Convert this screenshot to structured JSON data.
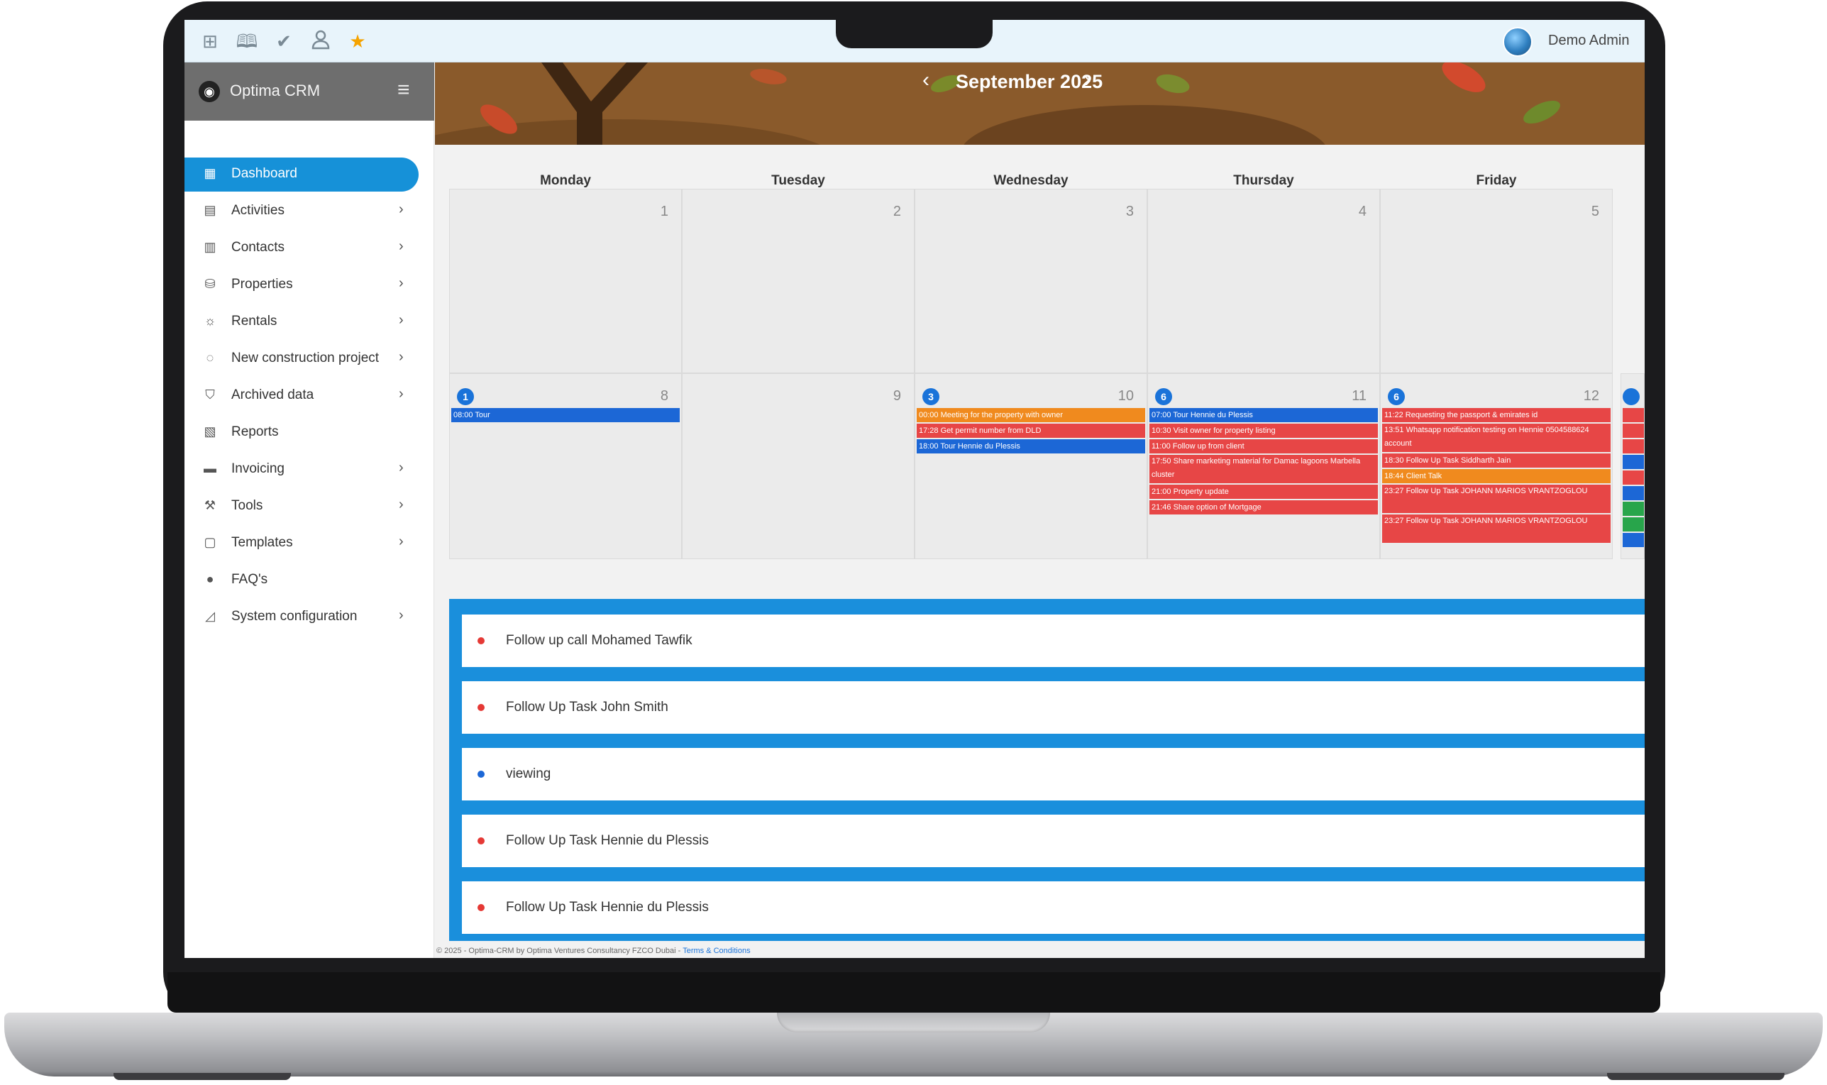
{
  "topbar": {
    "icons": [
      "grid-icon",
      "book-icon",
      "check-icon",
      "user-icon",
      "star-icon"
    ],
    "user_name": "Demo Admin"
  },
  "sidebar": {
    "brand": "Optima CRM",
    "items": [
      {
        "label": "Dashboard",
        "icon": "dashboard-icon",
        "active": true,
        "has_children": false
      },
      {
        "label": "Activities",
        "icon": "activities-icon",
        "has_children": true
      },
      {
        "label": "Contacts",
        "icon": "contacts-icon",
        "has_children": true
      },
      {
        "label": "Properties",
        "icon": "properties-icon",
        "has_children": true
      },
      {
        "label": "Rentals",
        "icon": "rentals-icon",
        "has_children": true
      },
      {
        "label": "New construction project",
        "icon": "construction-icon",
        "has_children": true
      },
      {
        "label": "Archived data",
        "icon": "archive-icon",
        "has_children": true
      },
      {
        "label": "Reports",
        "icon": "reports-icon",
        "has_children": false
      },
      {
        "label": "Invoicing",
        "icon": "invoicing-icon",
        "has_children": true
      },
      {
        "label": "Tools",
        "icon": "tools-icon",
        "has_children": true
      },
      {
        "label": "Templates",
        "icon": "templates-icon",
        "has_children": true
      },
      {
        "label": "FAQ's",
        "icon": "faq-icon",
        "has_children": false
      },
      {
        "label": "System configuration",
        "icon": "settings-icon",
        "has_children": true
      }
    ]
  },
  "calendar": {
    "title": "September 2025",
    "prev": "‹",
    "next": "›",
    "weekdays": [
      "Monday",
      "Tuesday",
      "Wednesday",
      "Thursday",
      "Friday"
    ],
    "week1": [
      "1",
      "2",
      "3",
      "4",
      "5"
    ],
    "week2": [
      {
        "day": "8",
        "badge": "1",
        "events": [
          {
            "text": "08:00 Tour",
            "color": "blue"
          }
        ]
      },
      {
        "day": "9",
        "badge": "",
        "events": []
      },
      {
        "day": "10",
        "badge": "3",
        "events": [
          {
            "text": "00:00 Meeting for the property with owner",
            "color": "orange"
          },
          {
            "text": "17:28 Get permit number from DLD",
            "color": "red"
          },
          {
            "text": "18:00 Tour Hennie du Plessis",
            "color": "blue"
          }
        ]
      },
      {
        "day": "11",
        "badge": "6",
        "events": [
          {
            "text": "07:00 Tour Hennie du Plessis",
            "color": "blue"
          },
          {
            "text": "10:30 Visit owner for property listing",
            "color": "red"
          },
          {
            "text": "11:00 Follow up from client",
            "color": "red"
          },
          {
            "text": "17:50 Share marketing material for Damac lagoons Marbella cluster",
            "color": "red",
            "tall": true
          },
          {
            "text": "21:00 Property update",
            "color": "red"
          },
          {
            "text": "21:46 Share option of Mortgage",
            "color": "red"
          }
        ]
      },
      {
        "day": "12",
        "badge": "6",
        "events": [
          {
            "text": "11:22 Requesting the passport & emirates id",
            "color": "red"
          },
          {
            "text": "13:51 Whatsapp notification testing on Hennie 0504588624 account",
            "color": "red",
            "tall": true
          },
          {
            "text": "18:30 Follow Up Task Siddharth Jain",
            "color": "red"
          },
          {
            "text": "18:44 Client Talk",
            "color": "orange"
          },
          {
            "text": "23:27 Follow Up Task JOHANN MARIOS VRANTZOGLOU",
            "color": "red",
            "tall": true
          },
          {
            "text": "23:27 Follow Up Task JOHANN MARIOS VRANTZOGLOU",
            "color": "red",
            "tall": true
          }
        ]
      }
    ]
  },
  "tasks": [
    {
      "text": "Follow up call Mohamed Tawfik",
      "color": "#e53935"
    },
    {
      "text": "Follow Up Task John Smith",
      "color": "#e53935"
    },
    {
      "text": "viewing",
      "color": "#1c67d6"
    },
    {
      "text": "Follow Up Task Hennie du Plessis",
      "color": "#e53935"
    },
    {
      "text": "Follow Up Task Hennie du Plessis",
      "color": "#e53935"
    }
  ],
  "footer": {
    "text": "© 2025 - Optima-CRM by Optima Ventures Consultancy FZCO Dubai - ",
    "link": "Terms & Conditions"
  },
  "colors": {
    "accent": "#1691d8",
    "event_red": "#e74646",
    "event_blue": "#1c67d6",
    "event_orange": "#f08a1e",
    "event_green": "#28a54b"
  }
}
